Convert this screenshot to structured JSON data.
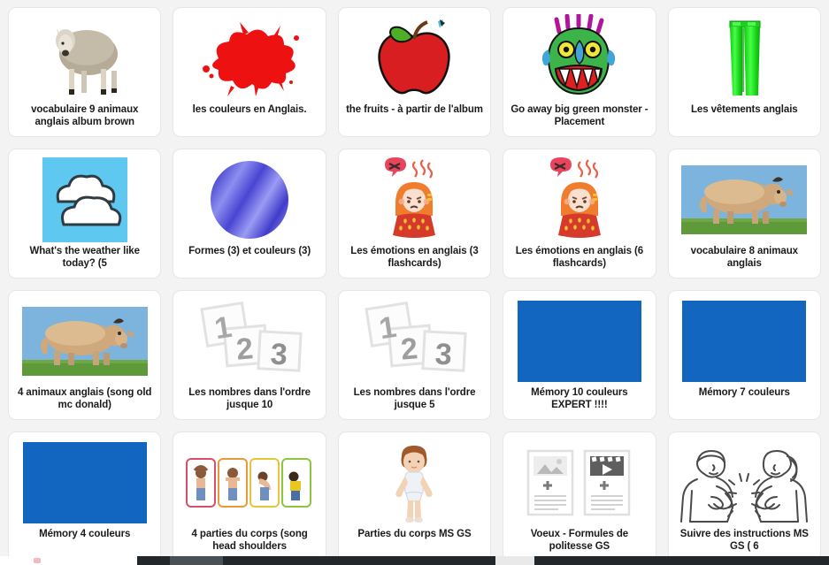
{
  "page": {
    "background_color": "#f3f3f3",
    "card_background": "#ffffff",
    "columns": 5,
    "rows": 4
  },
  "colors": {
    "memory_blue": "#1266bf",
    "sky_blue": "#5ec8f0",
    "apple_red": "#d81e20",
    "splat_red": "#ee1111",
    "monster_green": "#3cb44a",
    "pants_green": "#2ee62e",
    "grass_green": "#5f9a3a",
    "emotion_orange": "#f07d2e",
    "caption_text": "#1b1b1b",
    "taskbar": "#22272b"
  },
  "cards": [
    {
      "label": "vocabulaire 9 animaux anglais album brown",
      "icon": "sheep-photo-icon"
    },
    {
      "label": "les couleurs en Anglais.",
      "icon": "red-paint-splat-icon"
    },
    {
      "label": "the fruits - à partir de l'album",
      "icon": "red-apple-icon"
    },
    {
      "label": "Go away big green monster - Placement",
      "icon": "green-monster-icon"
    },
    {
      "label": "Les vêtements anglais",
      "icon": "green-pants-icon"
    },
    {
      "label": "What's the weather like today? (5",
      "icon": "clouds-weather-icon"
    },
    {
      "label": "Formes (3) et couleurs (3)",
      "icon": "blue-gradient-circle-icon"
    },
    {
      "label": "Les émotions en anglais (3 flashcards)",
      "icon": "angry-girl-icon"
    },
    {
      "label": "Les émotions en anglais (6 flashcards)",
      "icon": "angry-girl-icon"
    },
    {
      "label": "vocabulaire 8 animaux anglais",
      "icon": "cow-photo-icon"
    },
    {
      "label": "4 animaux anglais (song old mc donald)",
      "icon": "cow-photo-icon"
    },
    {
      "label": "Les nombres dans l'ordre jusque 10",
      "icon": "number-cards-icon"
    },
    {
      "label": "Les nombres dans l'ordre jusque 5",
      "icon": "number-cards-icon"
    },
    {
      "label": "Mémory 10 couleurs EXPERT !!!!",
      "icon": "blue-rectangle-icon"
    },
    {
      "label": "Mémory 7 couleurs",
      "icon": "blue-rectangle-icon"
    },
    {
      "label": "Mémory 4 couleurs",
      "icon": "blue-rectangle-icon"
    },
    {
      "label": "4 parties du corps (song head shoulders",
      "icon": "body-parts-cards-icon"
    },
    {
      "label": "Parties du corps MS GS",
      "icon": "child-body-icon"
    },
    {
      "label": "Voeux - Formules de politesse GS",
      "icon": "document-placeholder-icon"
    },
    {
      "label": "Suivre des instructions MS GS ( 6",
      "icon": "two-people-clapping-icon"
    }
  ],
  "number_card_digits": [
    "1",
    "2",
    "3"
  ]
}
